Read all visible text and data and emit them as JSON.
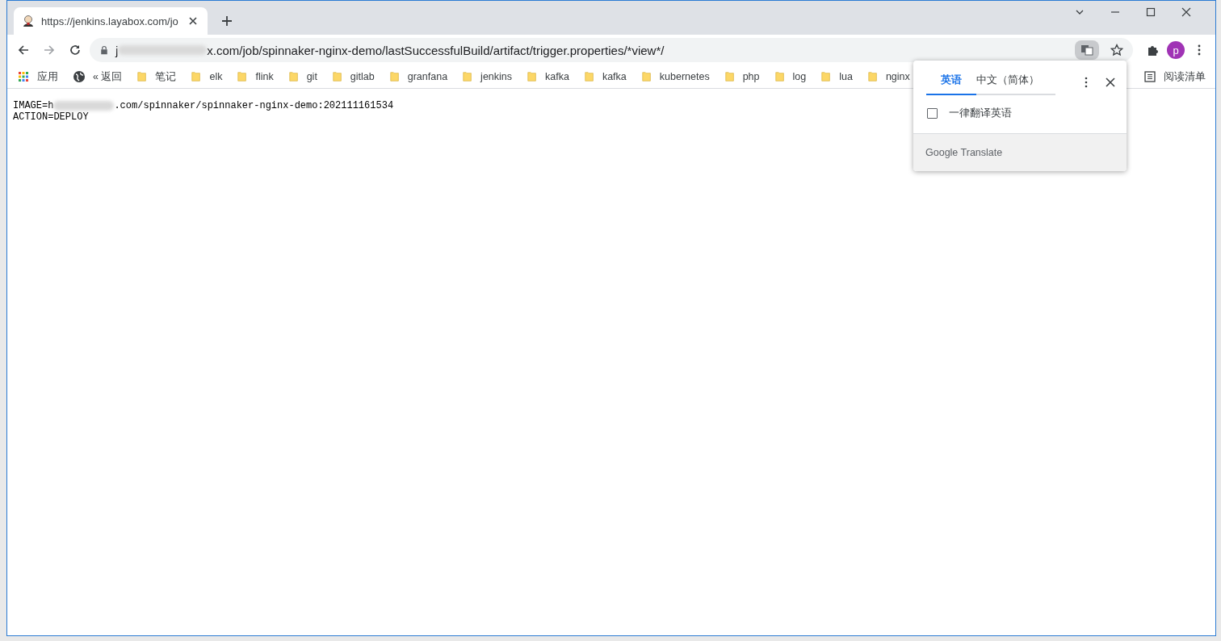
{
  "tab": {
    "title": "https://jenkins.layabox.com/jo"
  },
  "address": {
    "visible_start": "j",
    "visible_url": "x.com/job/spinnaker-nginx-demo/lastSuccessfulBuild/artifact/trigger.properties/*view*/"
  },
  "profile": {
    "initial": "p"
  },
  "bookmarks": [
    {
      "kind": "apps",
      "label": "应用"
    },
    {
      "kind": "globe",
      "label": "« 返回"
    },
    {
      "kind": "folder",
      "label": "笔记"
    },
    {
      "kind": "folder",
      "label": "elk"
    },
    {
      "kind": "folder",
      "label": "flink"
    },
    {
      "kind": "folder",
      "label": "git"
    },
    {
      "kind": "folder",
      "label": "gitlab"
    },
    {
      "kind": "folder",
      "label": "granfana"
    },
    {
      "kind": "folder",
      "label": "jenkins"
    },
    {
      "kind": "folder",
      "label": "kafka"
    },
    {
      "kind": "folder",
      "label": "kafka"
    },
    {
      "kind": "folder",
      "label": "kubernetes"
    },
    {
      "kind": "folder",
      "label": "php"
    },
    {
      "kind": "folder",
      "label": "log"
    },
    {
      "kind": "folder",
      "label": "lua"
    },
    {
      "kind": "folder",
      "label": "nginx"
    }
  ],
  "reading_list": {
    "label": "阅读清单"
  },
  "content": {
    "image_line": {
      "before": "IMAGE=h",
      "after": ".com/spinnaker/spinnaker-nginx-demo:202111161534"
    },
    "action_line": "ACTION=DEPLOY"
  },
  "translate_popup": {
    "tabs": [
      {
        "label": "英语",
        "selected": true
      },
      {
        "label": "中文（简体）",
        "selected": false
      }
    ],
    "always_translate": {
      "label": "一律翻译英语",
      "checked": false
    },
    "footer": "Google Translate"
  }
}
